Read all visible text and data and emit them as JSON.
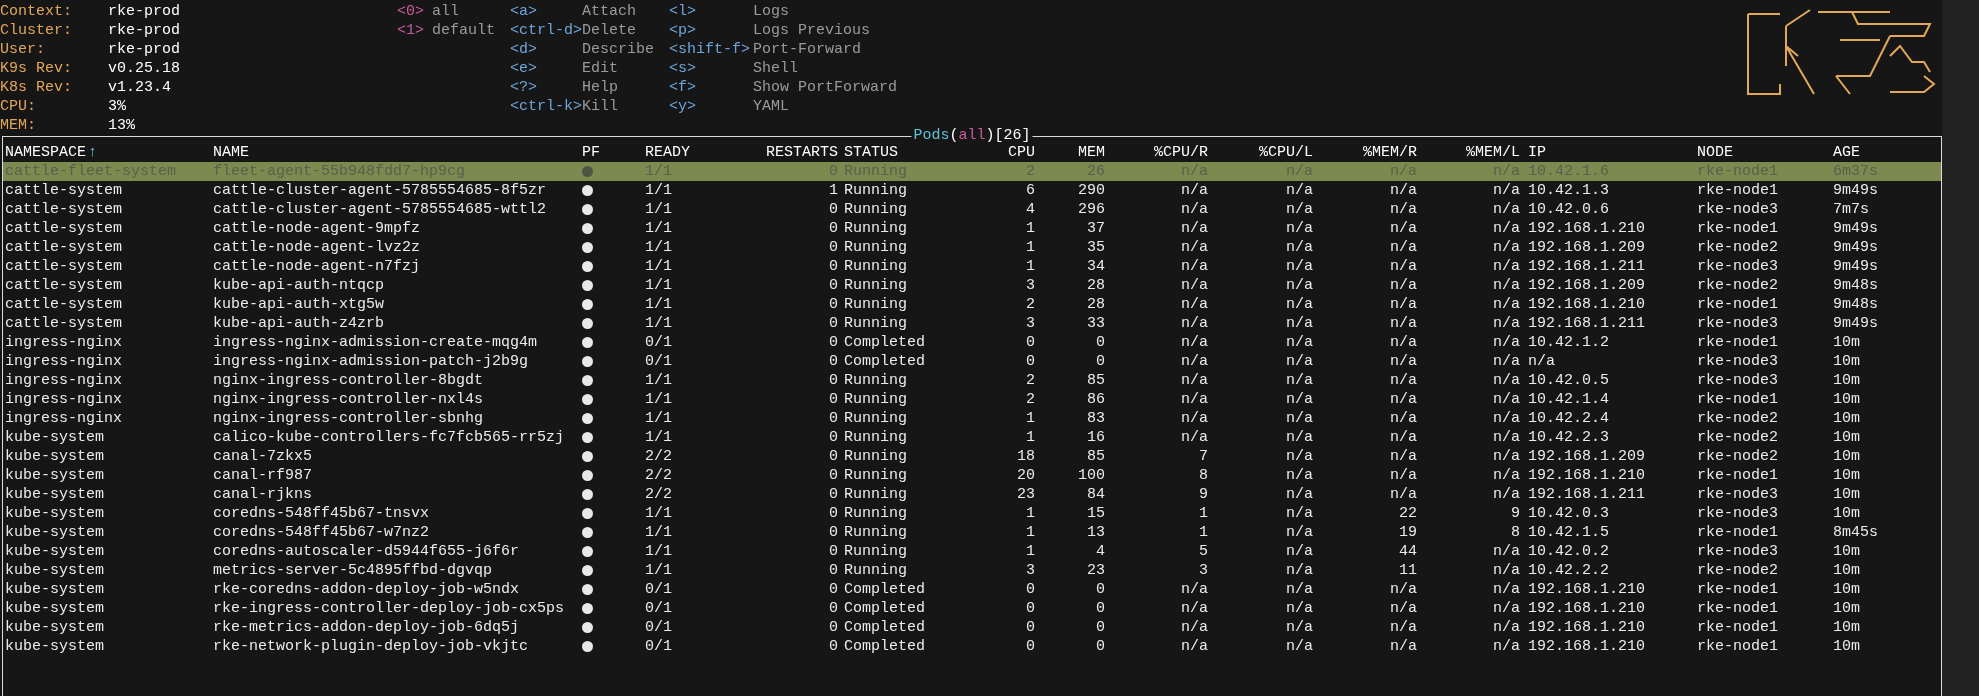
{
  "cluster_info": [
    {
      "label": "Context:",
      "value": "rke-prod"
    },
    {
      "label": "Cluster:",
      "value": "rke-prod"
    },
    {
      "label": "User:",
      "value": "rke-prod"
    },
    {
      "label": "K9s Rev:",
      "value": "v0.25.18"
    },
    {
      "label": "K8s Rev:",
      "value": "v1.23.4"
    },
    {
      "label": "CPU:",
      "value": "3%"
    },
    {
      "label": "MEM:",
      "value": "13%"
    }
  ],
  "namespace_shortcuts": [
    {
      "key": "<0>",
      "label": "all"
    },
    {
      "key": "<1>",
      "label": "default"
    }
  ],
  "action_shortcuts": [
    [
      {
        "key": "<a>",
        "label": "Attach"
      },
      {
        "key": "<ctrl-d>",
        "label": "Delete"
      },
      {
        "key": "<d>",
        "label": "Describe"
      },
      {
        "key": "<e>",
        "label": "Edit"
      },
      {
        "key": "<?>",
        "label": "Help"
      },
      {
        "key": "<ctrl-k>",
        "label": "Kill"
      }
    ],
    [
      {
        "key": "<l>",
        "label": "Logs"
      },
      {
        "key": "<p>",
        "label": "Logs Previous"
      },
      {
        "key": "<shift-f>",
        "label": "Port-Forward"
      },
      {
        "key": "<s>",
        "label": "Shell"
      },
      {
        "key": "<f>",
        "label": "Show PortForward"
      },
      {
        "key": "<y>",
        "label": "YAML"
      }
    ]
  ],
  "table": {
    "title_parts": [
      {
        "kind": "resource",
        "text": "Pods"
      },
      {
        "kind": "punct",
        "text": "("
      },
      {
        "kind": "namespace",
        "text": "all"
      },
      {
        "kind": "punct",
        "text": ")["
      },
      {
        "kind": "count",
        "text": "26"
      },
      {
        "kind": "punct",
        "text": "]"
      }
    ],
    "sort_indicator": "↑",
    "columns": [
      "NAMESPACE",
      "NAME",
      "PF",
      "READY",
      "RESTARTS",
      "STATUS",
      "CPU",
      "MEM",
      "%CPU/R",
      "%CPU/L",
      "%MEM/R",
      "%MEM/L",
      "IP",
      "NODE",
      "AGE"
    ],
    "rows": [
      {
        "selected": true,
        "cells": [
          "cattle-fleet-system",
          "fleet-agent-55b948fdd7-hp9cg",
          "",
          "1/1",
          "0",
          "Running",
          "2",
          "26",
          "n/a",
          "n/a",
          "n/a",
          "n/a",
          "10.42.1.6",
          "rke-node1",
          "6m37s"
        ]
      },
      {
        "selected": false,
        "cells": [
          "cattle-system",
          "cattle-cluster-agent-5785554685-8f5zr",
          "",
          "1/1",
          "1",
          "Running",
          "6",
          "290",
          "n/a",
          "n/a",
          "n/a",
          "n/a",
          "10.42.1.3",
          "rke-node1",
          "9m49s"
        ]
      },
      {
        "selected": false,
        "cells": [
          "cattle-system",
          "cattle-cluster-agent-5785554685-wttl2",
          "",
          "1/1",
          "0",
          "Running",
          "4",
          "296",
          "n/a",
          "n/a",
          "n/a",
          "n/a",
          "10.42.0.6",
          "rke-node3",
          "7m7s"
        ]
      },
      {
        "selected": false,
        "cells": [
          "cattle-system",
          "cattle-node-agent-9mpfz",
          "",
          "1/1",
          "0",
          "Running",
          "1",
          "37",
          "n/a",
          "n/a",
          "n/a",
          "n/a",
          "192.168.1.210",
          "rke-node1",
          "9m49s"
        ]
      },
      {
        "selected": false,
        "cells": [
          "cattle-system",
          "cattle-node-agent-lvz2z",
          "",
          "1/1",
          "0",
          "Running",
          "1",
          "35",
          "n/a",
          "n/a",
          "n/a",
          "n/a",
          "192.168.1.209",
          "rke-node2",
          "9m49s"
        ]
      },
      {
        "selected": false,
        "cells": [
          "cattle-system",
          "cattle-node-agent-n7fzj",
          "",
          "1/1",
          "0",
          "Running",
          "1",
          "34",
          "n/a",
          "n/a",
          "n/a",
          "n/a",
          "192.168.1.211",
          "rke-node3",
          "9m49s"
        ]
      },
      {
        "selected": false,
        "cells": [
          "cattle-system",
          "kube-api-auth-ntqcp",
          "",
          "1/1",
          "0",
          "Running",
          "3",
          "28",
          "n/a",
          "n/a",
          "n/a",
          "n/a",
          "192.168.1.209",
          "rke-node2",
          "9m48s"
        ]
      },
      {
        "selected": false,
        "cells": [
          "cattle-system",
          "kube-api-auth-xtg5w",
          "",
          "1/1",
          "0",
          "Running",
          "2",
          "28",
          "n/a",
          "n/a",
          "n/a",
          "n/a",
          "192.168.1.210",
          "rke-node1",
          "9m48s"
        ]
      },
      {
        "selected": false,
        "cells": [
          "cattle-system",
          "kube-api-auth-z4zrb",
          "",
          "1/1",
          "0",
          "Running",
          "3",
          "33",
          "n/a",
          "n/a",
          "n/a",
          "n/a",
          "192.168.1.211",
          "rke-node3",
          "9m49s"
        ]
      },
      {
        "selected": false,
        "cells": [
          "ingress-nginx",
          "ingress-nginx-admission-create-mqg4m",
          "",
          "0/1",
          "0",
          "Completed",
          "0",
          "0",
          "n/a",
          "n/a",
          "n/a",
          "n/a",
          "10.42.1.2",
          "rke-node1",
          "10m"
        ]
      },
      {
        "selected": false,
        "cells": [
          "ingress-nginx",
          "ingress-nginx-admission-patch-j2b9g",
          "",
          "0/1",
          "0",
          "Completed",
          "0",
          "0",
          "n/a",
          "n/a",
          "n/a",
          "n/a",
          "n/a",
          "rke-node3",
          "10m"
        ]
      },
      {
        "selected": false,
        "cells": [
          "ingress-nginx",
          "nginx-ingress-controller-8bgdt",
          "",
          "1/1",
          "0",
          "Running",
          "2",
          "85",
          "n/a",
          "n/a",
          "n/a",
          "n/a",
          "10.42.0.5",
          "rke-node3",
          "10m"
        ]
      },
      {
        "selected": false,
        "cells": [
          "ingress-nginx",
          "nginx-ingress-controller-nxl4s",
          "",
          "1/1",
          "0",
          "Running",
          "2",
          "86",
          "n/a",
          "n/a",
          "n/a",
          "n/a",
          "10.42.1.4",
          "rke-node1",
          "10m"
        ]
      },
      {
        "selected": false,
        "cells": [
          "ingress-nginx",
          "nginx-ingress-controller-sbnhg",
          "",
          "1/1",
          "0",
          "Running",
          "1",
          "83",
          "n/a",
          "n/a",
          "n/a",
          "n/a",
          "10.42.2.4",
          "rke-node2",
          "10m"
        ]
      },
      {
        "selected": false,
        "cells": [
          "kube-system",
          "calico-kube-controllers-fc7fcb565-rr5zj",
          "",
          "1/1",
          "0",
          "Running",
          "1",
          "16",
          "n/a",
          "n/a",
          "n/a",
          "n/a",
          "10.42.2.3",
          "rke-node2",
          "10m"
        ]
      },
      {
        "selected": false,
        "cells": [
          "kube-system",
          "canal-7zkx5",
          "",
          "2/2",
          "0",
          "Running",
          "18",
          "85",
          "7",
          "n/a",
          "n/a",
          "n/a",
          "192.168.1.209",
          "rke-node2",
          "10m"
        ]
      },
      {
        "selected": false,
        "cells": [
          "kube-system",
          "canal-rf987",
          "",
          "2/2",
          "0",
          "Running",
          "20",
          "100",
          "8",
          "n/a",
          "n/a",
          "n/a",
          "192.168.1.210",
          "rke-node1",
          "10m"
        ]
      },
      {
        "selected": false,
        "cells": [
          "kube-system",
          "canal-rjkns",
          "",
          "2/2",
          "0",
          "Running",
          "23",
          "84",
          "9",
          "n/a",
          "n/a",
          "n/a",
          "192.168.1.211",
          "rke-node3",
          "10m"
        ]
      },
      {
        "selected": false,
        "cells": [
          "kube-system",
          "coredns-548ff45b67-tnsvx",
          "",
          "1/1",
          "0",
          "Running",
          "1",
          "15",
          "1",
          "n/a",
          "22",
          "9",
          "10.42.0.3",
          "rke-node3",
          "10m"
        ]
      },
      {
        "selected": false,
        "cells": [
          "kube-system",
          "coredns-548ff45b67-w7nz2",
          "",
          "1/1",
          "0",
          "Running",
          "1",
          "13",
          "1",
          "n/a",
          "19",
          "8",
          "10.42.1.5",
          "rke-node1",
          "8m45s"
        ]
      },
      {
        "selected": false,
        "cells": [
          "kube-system",
          "coredns-autoscaler-d5944f655-j6f6r",
          "",
          "1/1",
          "0",
          "Running",
          "1",
          "4",
          "5",
          "n/a",
          "44",
          "n/a",
          "10.42.0.2",
          "rke-node3",
          "10m"
        ]
      },
      {
        "selected": false,
        "cells": [
          "kube-system",
          "metrics-server-5c4895ffbd-dgvqp",
          "",
          "1/1",
          "0",
          "Running",
          "3",
          "23",
          "3",
          "n/a",
          "11",
          "n/a",
          "10.42.2.2",
          "rke-node2",
          "10m"
        ]
      },
      {
        "selected": false,
        "cells": [
          "kube-system",
          "rke-coredns-addon-deploy-job-w5ndx",
          "",
          "0/1",
          "0",
          "Completed",
          "0",
          "0",
          "n/a",
          "n/a",
          "n/a",
          "n/a",
          "192.168.1.210",
          "rke-node1",
          "10m"
        ]
      },
      {
        "selected": false,
        "cells": [
          "kube-system",
          "rke-ingress-controller-deploy-job-cx5ps",
          "",
          "0/1",
          "0",
          "Completed",
          "0",
          "0",
          "n/a",
          "n/a",
          "n/a",
          "n/a",
          "192.168.1.210",
          "rke-node1",
          "10m"
        ]
      },
      {
        "selected": false,
        "cells": [
          "kube-system",
          "rke-metrics-addon-deploy-job-6dq5j",
          "",
          "0/1",
          "0",
          "Completed",
          "0",
          "0",
          "n/a",
          "n/a",
          "n/a",
          "n/a",
          "192.168.1.210",
          "rke-node1",
          "10m"
        ]
      },
      {
        "selected": false,
        "cells": [
          "kube-system",
          "rke-network-plugin-deploy-job-vkjtc",
          "",
          "0/1",
          "0",
          "Completed",
          "0",
          "0",
          "n/a",
          "n/a",
          "n/a",
          "n/a",
          "192.168.1.210",
          "rke-node1",
          "10m"
        ]
      }
    ]
  }
}
